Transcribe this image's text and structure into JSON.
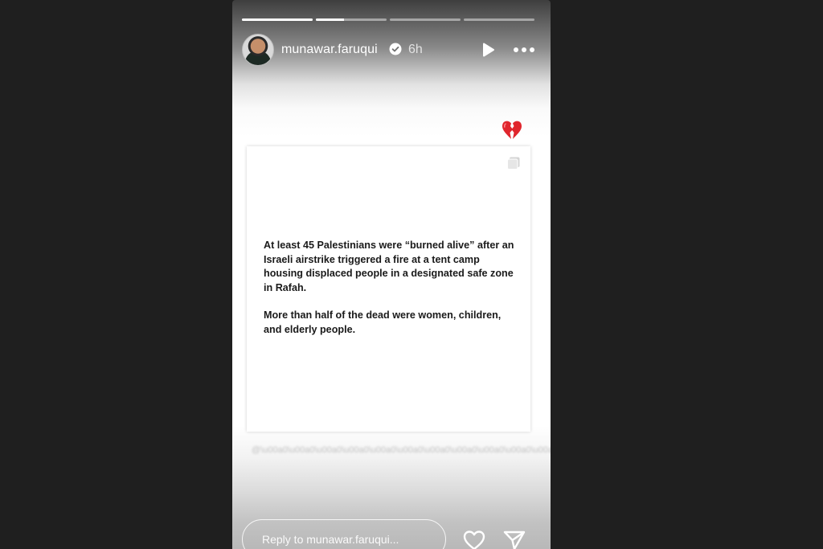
{
  "story": {
    "progress": [
      1.0,
      0.4,
      0.0,
      0.0
    ],
    "header": {
      "avatar_icon": "profile-avatar",
      "username": "munawar.faruqui",
      "verified_icon": "verified-badge-icon",
      "time": "6h",
      "play_icon": "play-icon",
      "more_icon": "more-dots-icon"
    },
    "sticker_icon": "broken-heart-emoji",
    "post": {
      "corner_icon": "multiple-images-icon",
      "paragraphs": [
        "At least 45 Palestinians were “burned alive” after an Israeli airstrike triggered a fire at a tent camp housing displaced people in a designated safe zone in Rafah.",
        "More than half of the dead were women, children, and elderly people."
      ]
    },
    "reply": {
      "placeholder": "Reply to munawar.faruqui..."
    },
    "actions": {
      "like_icon": "heart-icon",
      "share_icon": "send-icon"
    }
  }
}
